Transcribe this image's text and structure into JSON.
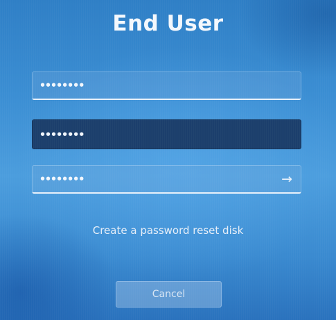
{
  "account": {
    "name": "End User"
  },
  "fields": {
    "old_password_mask": "••••••••",
    "new_password_mask": "••••••••",
    "confirm_password_mask": "••••••••",
    "submit_arrow": "→"
  },
  "links": {
    "reset_disk": "Create a password reset disk"
  },
  "buttons": {
    "cancel": "Cancel"
  },
  "icons": {
    "submit": "arrow-right-icon"
  },
  "colors": {
    "background": "#3b8ed3",
    "focused_field": "#1c3f6c",
    "text": "#ffffff"
  }
}
